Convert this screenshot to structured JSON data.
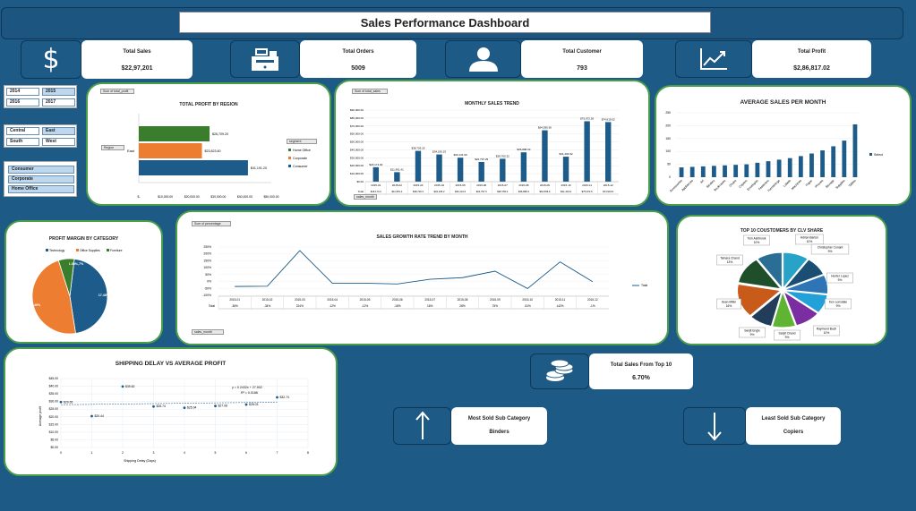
{
  "header": {
    "title": "Sales Performance Dashboard"
  },
  "kpis": [
    {
      "label": "Total Sales",
      "value": "$22,97,201",
      "icon": "dollar-icon"
    },
    {
      "label": "Total Orders",
      "value": "5009",
      "icon": "cash-register-icon"
    },
    {
      "label": "Total Customer",
      "value": "793",
      "icon": "user-icon"
    },
    {
      "label": "Total Profit",
      "value": "$2,86,817.02",
      "icon": "line-trend-icon"
    }
  ],
  "slicers": {
    "years": [
      "2014",
      "2015",
      "2016",
      "2017"
    ],
    "regions": [
      "Central",
      "East",
      "South",
      "West"
    ],
    "segments": [
      "Consumer",
      "Corporate",
      "Home Office"
    ]
  },
  "colors": {
    "background": "#1e5a86",
    "bar_blue": "#1d5c8a",
    "orange": "#ed7d31",
    "green": "#3a7d2c",
    "panel_border": "#4a9e4a"
  },
  "profit_by_region": {
    "title": "TOTAL PROFIT BY REGION",
    "field_button": "Sum of total_profit",
    "filter_button": "Region",
    "legend_button": "segment",
    "category": "East",
    "legend": [
      "Home Office",
      "Corporate",
      "Consumer"
    ],
    "bar_labels": [
      "$26,709.20",
      "$23,823.60",
      "$41,191.20"
    ],
    "ticks": [
      "$-",
      "$10,000.00",
      "$20,000.00",
      "$30,000.00",
      "$40,000.00",
      "$50,000.00"
    ]
  },
  "monthly_sales": {
    "title": "MONTHLY SALES TREND",
    "field_button": "Sum of total_sales",
    "axis_button": "sales_month",
    "y_ticks": [
      "$90,000.00",
      "$80,000.00",
      "$70,000.00",
      "$60,000.00",
      "$50,000.00",
      "$40,000.00",
      "$30,000.00",
      "$20,000.00",
      "$10,000.00",
      "$0.00"
    ],
    "months": [
      "2015-01",
      "2015-02",
      "2015-03",
      "2015-04",
      "2015-05",
      "2015-06",
      "2015-07",
      "2015-08",
      "2015-09",
      "2015-10",
      "2015-11",
      "2015-12"
    ],
    "data_labels": [
      "$18,174.00",
      "$11,951.41",
      "$38,726.25",
      "$34,195.23",
      "$30,131.69",
      "$24,797.29",
      "$28,765.32",
      "$36,898.33",
      "$64,595.90",
      "$31,404.92",
      "$75,972.55",
      "$74,919.52"
    ],
    "table_row_label": "Total",
    "table_values": [
      "$18,174.0",
      "$11,951.4",
      "$38,726.3",
      "$34,195.2",
      "$30,131.6",
      "$24,797.3",
      "$28,765.3",
      "$36,898.3",
      "$64,595.9",
      "$31,404.9",
      "$75,972.5",
      "$74,919.5"
    ]
  },
  "avg_sales_month": {
    "title": "AVERAGE SALES PER MONTH",
    "legend": "Select",
    "y_ticks": [
      "250",
      "200",
      "150",
      "100",
      "50",
      "0"
    ],
    "categories": [
      "Accessories",
      "Appliances",
      "Art",
      "Binders",
      "Bookcases",
      "Chairs",
      "Copiers",
      "Envelopes",
      "Fasteners",
      "Furnishings",
      "Labels",
      "Machines",
      "Paper",
      "Phones",
      "Storage",
      "Supplies",
      "Tables"
    ]
  },
  "profit_margin": {
    "title": "PROFIT MARGIN BY CATEGORY",
    "legend": [
      "Technology",
      "Office Supplies",
      "Furniture"
    ],
    "labels": [
      "17.48%,47%",
      "17.69%,49%",
      "1.54%,7%"
    ]
  },
  "growth_rate": {
    "title": "SALES GROWTH RATE TREND BY MONTH",
    "field_button": "Sum of percentage",
    "axis_button": "sales_month",
    "legend": "Total",
    "y_ticks": [
      "250%",
      "200%",
      "150%",
      "100%",
      "50%",
      "0%",
      "-50%",
      "-100%"
    ],
    "months": [
      "2015-01",
      "2015-02",
      "2015-03",
      "2015-04",
      "2015-05",
      "2015-06",
      "2015-07",
      "2015-08",
      "2015-09",
      "2015-10",
      "2015-11",
      "2015-12"
    ],
    "table_row_label": "Total",
    "table_values": [
      "-36%",
      "-34%",
      "224%",
      "-12%",
      "-12%",
      "-18%",
      "16%",
      "28%",
      "75%",
      "-51%",
      "142%",
      "-1%"
    ]
  },
  "clv_share": {
    "title": "TOP 10 COUSTOMERS BY CLV SHARE",
    "labels": [
      {
        "name": "Tom Ashbrook",
        "pct": "10%"
      },
      {
        "name": "Adrian Barton",
        "pct": "10%"
      },
      {
        "name": "Christopher Conant",
        "pct": "9%"
      },
      {
        "name": "Hunter Lopez",
        "pct": "9%"
      },
      {
        "name": "Ken Lonsdale",
        "pct": "9%"
      },
      {
        "name": "Raymond Buch",
        "pct": "10%"
      },
      {
        "name": "Sanjit Chand",
        "pct": "9%"
      },
      {
        "name": "Sanjit Engle",
        "pct": "9%"
      },
      {
        "name": "Sean Miller",
        "pct": "16%"
      },
      {
        "name": "Tamara Chand",
        "pct": "13%"
      }
    ]
  },
  "shipping": {
    "title": "SHIPPING DELAY VS AVERAGE PROFIT",
    "xlabel": "Shipping Delay (Days)",
    "ylabel": "Average profit",
    "equation": "y = 0.2432x + 27.902",
    "r2": "R² = 0.0186",
    "y_ticks": [
      "$45.00",
      "$40.00",
      "$35.00",
      "$30.00",
      "$25.00",
      "$20.00",
      "$15.00",
      "$10.00",
      "$5.00",
      "$0.00"
    ],
    "x_ticks": [
      "0",
      "1",
      "2",
      "3",
      "4",
      "5",
      "6",
      "7",
      "8"
    ]
  },
  "top10_sales": {
    "label": "Total Sales From Top 10",
    "value": "6.70%",
    "icon": "coins-icon"
  },
  "most_sold": {
    "label": "Most Sold Sub Category",
    "value": "Binders",
    "icon": "arrow-up-icon"
  },
  "least_sold": {
    "label": "Least Sold Sub Category",
    "value": "Copiers",
    "icon": "arrow-down-icon"
  },
  "chart_data": [
    {
      "type": "bar",
      "title": "TOTAL PROFIT BY REGION",
      "categories": [
        "East"
      ],
      "series": [
        {
          "name": "Home Office",
          "values": [
            26709.2
          ]
        },
        {
          "name": "Corporate",
          "values": [
            23823.6
          ]
        },
        {
          "name": "Consumer",
          "values": [
            41191.2
          ]
        }
      ],
      "xlim": [
        0,
        50000
      ]
    },
    {
      "type": "bar",
      "title": "MONTHLY SALES TREND",
      "categories": [
        "2015-01",
        "2015-02",
        "2015-03",
        "2015-04",
        "2015-05",
        "2015-06",
        "2015-07",
        "2015-08",
        "2015-09",
        "2015-10",
        "2015-11",
        "2015-12"
      ],
      "values": [
        18174.0,
        11951.41,
        38726.25,
        34195.23,
        30131.69,
        24797.29,
        28765.32,
        36898.33,
        64595.9,
        31404.92,
        75972.55,
        74919.52
      ],
      "ylim": [
        0,
        90000
      ]
    },
    {
      "type": "bar",
      "title": "AVERAGE SALES PER MONTH",
      "categories": [
        "Accessories",
        "Appliances",
        "Art",
        "Binders",
        "Bookcases",
        "Chairs",
        "Copiers",
        "Envelopes",
        "Fasteners",
        "Furnishings",
        "Labels",
        "Machines",
        "Paper",
        "Phones",
        "Storage",
        "Supplies",
        "Tables"
      ],
      "values": [
        38,
        40,
        42,
        44,
        46,
        48,
        50,
        56,
        62,
        68,
        74,
        82,
        92,
        104,
        120,
        142,
        205
      ],
      "ylim": [
        0,
        250
      ]
    },
    {
      "type": "pie",
      "title": "PROFIT MARGIN BY CATEGORY",
      "categories": [
        "Technology",
        "Office Supplies",
        "Furniture"
      ],
      "values": [
        47,
        49,
        7
      ]
    },
    {
      "type": "line",
      "title": "SALES GROWTH RATE TREND BY MONTH",
      "x": [
        "2015-01",
        "2015-02",
        "2015-03",
        "2015-04",
        "2015-05",
        "2015-06",
        "2015-07",
        "2015-08",
        "2015-09",
        "2015-10",
        "2015-11",
        "2015-12"
      ],
      "values": [
        -36,
        -34,
        224,
        -12,
        -12,
        -18,
        16,
        28,
        75,
        -51,
        142,
        -1
      ],
      "ylim": [
        -100,
        250
      ]
    },
    {
      "type": "pie",
      "title": "TOP 10 COUSTOMERS BY CLV SHARE",
      "categories": [
        "Tom Ashbrook",
        "Adrian Barton",
        "Christopher Conant",
        "Hunter Lopez",
        "Ken Lonsdale",
        "Raymond Buch",
        "Sanjit Chand",
        "Sanjit Engle",
        "Sean Miller",
        "Tamara Chand"
      ],
      "values": [
        10,
        10,
        9,
        9,
        9,
        10,
        9,
        9,
        16,
        13
      ]
    },
    {
      "type": "scatter",
      "title": "SHIPPING DELAY VS AVERAGE PROFIT",
      "xlabel": "Shipping Delay (Days)",
      "ylabel": "Average profit",
      "x": [
        0,
        1,
        2,
        3,
        4,
        5,
        6,
        7
      ],
      "y": [
        29.65,
        20.44,
        39.82,
        26.74,
        25.94,
        27.08,
        28.03,
        32.74
      ],
      "point_labels": [
        "$29.65",
        "$20.44",
        "$39.82",
        "$26.74",
        "$25.94",
        "$27.08",
        "$28.03",
        "$32.74"
      ],
      "xlim": [
        0,
        8
      ],
      "ylim": [
        0,
        45
      ]
    }
  ]
}
